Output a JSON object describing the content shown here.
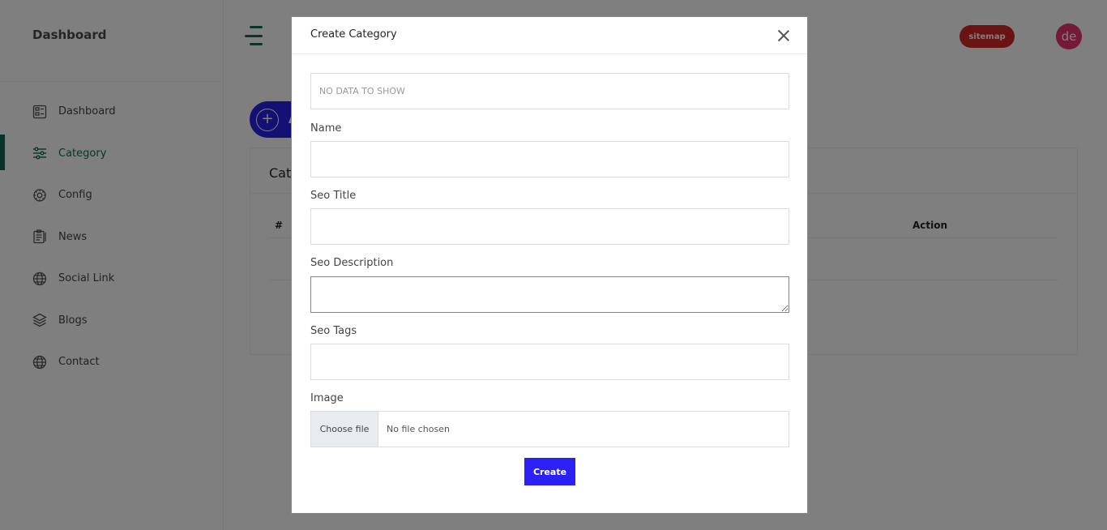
{
  "sidebar": {
    "brand": "Dashboard",
    "items": [
      {
        "label": "Dashboard",
        "icon": "dashboard-icon",
        "active": false
      },
      {
        "label": "Category",
        "icon": "sliders-icon",
        "active": true
      },
      {
        "label": "Config",
        "icon": "gear-icon",
        "active": false
      },
      {
        "label": "News",
        "icon": "clipboard-icon",
        "active": false
      },
      {
        "label": "Social Link",
        "icon": "globe-icon",
        "active": false
      },
      {
        "label": "Blogs",
        "icon": "layers-icon",
        "active": false
      },
      {
        "label": "Contact",
        "icon": "globe-icon",
        "active": false
      }
    ]
  },
  "header": {
    "sitemap_label": "sitemap",
    "avatar_initials": "de"
  },
  "main": {
    "add_button_label": "A",
    "card_title": "Cat",
    "table_headers": [
      "#",
      "Action"
    ]
  },
  "modal": {
    "title": "Create Category",
    "no_data_text": "NO DATA TO SHOW",
    "fields": {
      "name_label": "Name",
      "seo_title_label": "Seo Title",
      "seo_description_label": "Seo Description",
      "seo_tags_label": "Seo Tags",
      "image_label": "Image"
    },
    "file_button_label": "Choose file",
    "file_status": "No file chosen",
    "submit_label": "Create"
  },
  "colors": {
    "accent_green": "#0e6b57",
    "primary_blue": "#2b21f5",
    "sitemap_red": "#d32626",
    "avatar_pink": "#e8336f"
  }
}
